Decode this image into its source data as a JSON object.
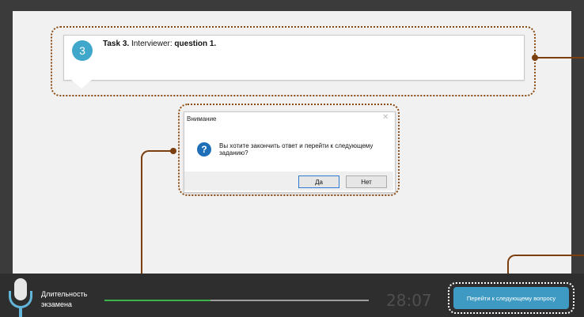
{
  "task": {
    "badge_number": "3",
    "label_bold": "Task 3.",
    "label_rest": " Interviewer: ",
    "question": "question 1."
  },
  "dialog": {
    "title": "Внимание",
    "close_icon": "close-icon",
    "message": "Вы хотите закончить ответ и перейти к следующему заданию?",
    "yes_label": "Да",
    "no_label": "Нет",
    "question_icon": "question-icon"
  },
  "bottom_bar": {
    "exam_duration_label": "Длительность экзамена",
    "timer": "28:07",
    "progress_fraction": 0.4,
    "next_button_label": "Перейти к следующему вопросу",
    "mic_icon": "microphone-icon"
  },
  "colors": {
    "highlight": "#8a4b12",
    "accent": "#3e9ac2",
    "progress": "#3bb44a"
  }
}
